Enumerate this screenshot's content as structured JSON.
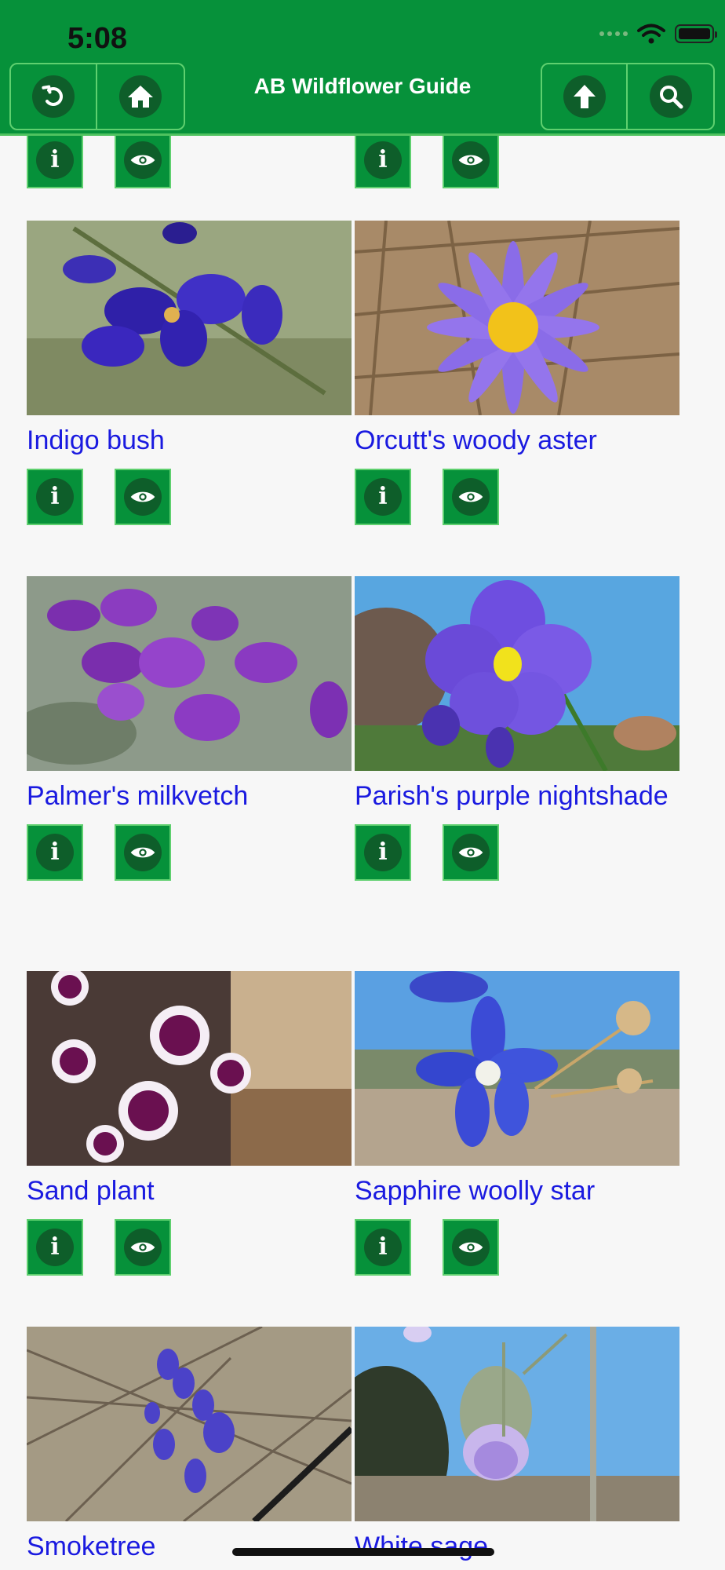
{
  "status_bar": {
    "time": "5:08"
  },
  "header": {
    "title": "AB Wildflower Guide",
    "left_buttons": [
      "back-icon",
      "home-icon"
    ],
    "right_buttons": [
      "up-arrow-icon",
      "search-icon"
    ]
  },
  "colors": {
    "header_bg": "#06913a",
    "button_circle": "#0e5e2a",
    "link_text": "#1a1ae0"
  },
  "flowers": [
    {
      "name": "Indigo bush"
    },
    {
      "name": "Orcutt's woody aster"
    },
    {
      "name": "Palmer's milkvetch"
    },
    {
      "name": "Parish's purple nightshade"
    },
    {
      "name": "Sand plant"
    },
    {
      "name": "Sapphire woolly star"
    },
    {
      "name": "Smoketree"
    },
    {
      "name": "White sage"
    }
  ],
  "card_actions": [
    "info-icon",
    "view-icon"
  ]
}
